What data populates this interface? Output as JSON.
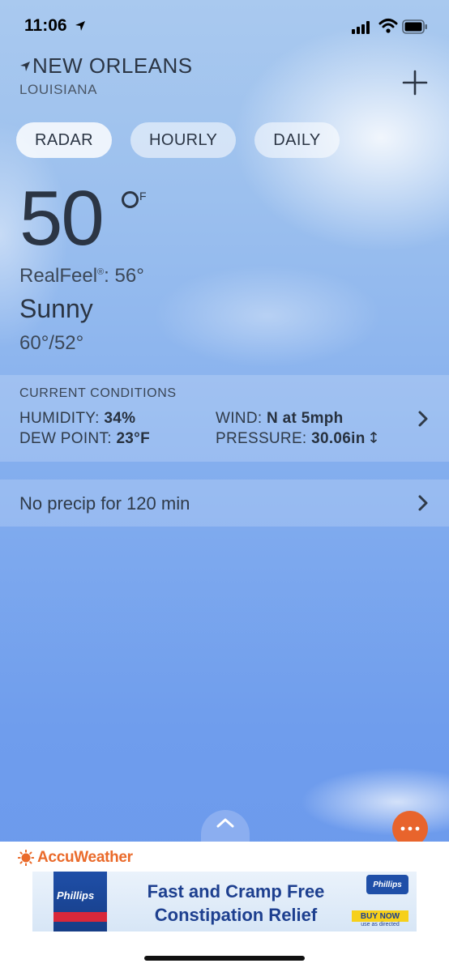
{
  "status_bar": {
    "time": "11:06"
  },
  "location": {
    "city": "NEW ORLEANS",
    "state": "LOUISIANA"
  },
  "tabs": [
    {
      "label": "RADAR",
      "active": true
    },
    {
      "label": "HOURLY",
      "active": false
    },
    {
      "label": "DAILY",
      "active": false
    }
  ],
  "current": {
    "temperature": "50",
    "unit": "F",
    "realfeel_label": "RealFeel",
    "realfeel_mark": "®",
    "realfeel_value": ": 56°",
    "condition": "Sunny",
    "hi_lo": "60°/52°"
  },
  "current_conditions": {
    "title": "CURRENT CONDITIONS",
    "humidity_label": "HUMIDITY:",
    "humidity_value": "34%",
    "dew_point_label": "DEW POINT:",
    "dew_point_value": "23°F",
    "wind_label": "WIND:",
    "wind_value": "N at 5mph",
    "pressure_label": "PRESSURE:",
    "pressure_value": "30.06in"
  },
  "precip": {
    "text": "No precip for 120 min"
  },
  "ad": {
    "brand_logo": "AccuWeather",
    "product_brand": "Phillips",
    "headline_line1": "Fast and Cramp Free",
    "headline_line2": "Constipation Relief",
    "badge": "Phillips",
    "cta": "BUY NOW",
    "disclaimer": "use as directed"
  },
  "colors": {
    "accent_orange": "#e8642c",
    "ad_blue": "#1d3f8f"
  },
  "icons": [
    "location-arrow-icon",
    "signal-icon",
    "wifi-icon",
    "battery-icon",
    "plus-icon",
    "chevron-right-icon",
    "chevron-up-icon",
    "more-dots-icon",
    "accuweather-sun-icon",
    "pressure-trend-icon"
  ]
}
